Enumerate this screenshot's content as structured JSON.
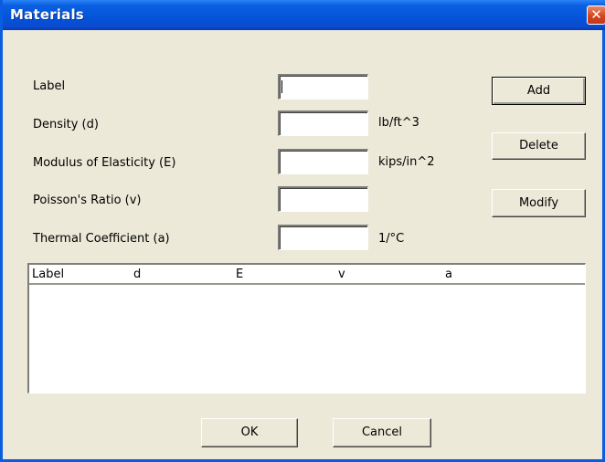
{
  "window": {
    "title": "Materials",
    "close_glyph": "✕"
  },
  "fields": {
    "label": {
      "caption": "Label",
      "value": "",
      "unit": ""
    },
    "density": {
      "caption": "Density (d)",
      "value": "",
      "unit": "lb/ft^3"
    },
    "modulus": {
      "caption": "Modulus of Elasticity (E)",
      "value": "",
      "unit": "kips/in^2"
    },
    "poisson": {
      "caption": "Poisson's Ratio (v)",
      "value": "",
      "unit": ""
    },
    "thermal": {
      "caption": "Thermal Coefficient (a)",
      "value": "",
      "unit": "1/°C"
    }
  },
  "actions": {
    "add": "Add",
    "delete": "Delete",
    "modify": "Modify"
  },
  "list": {
    "columns": [
      "Label",
      "d",
      "E",
      "v",
      "a"
    ],
    "rows": []
  },
  "footer": {
    "ok": "OK",
    "cancel": "Cancel"
  }
}
